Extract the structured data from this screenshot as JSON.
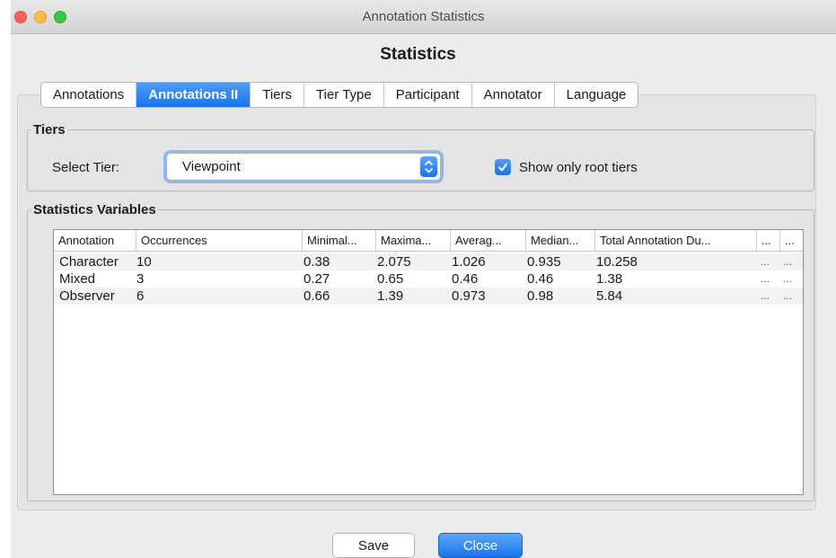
{
  "window": {
    "title": "Annotation Statistics"
  },
  "heading": "Statistics",
  "tabs": [
    {
      "label": "Annotations"
    },
    {
      "label": "Annotations II",
      "active": true
    },
    {
      "label": "Tiers"
    },
    {
      "label": "Tier Type"
    },
    {
      "label": "Participant"
    },
    {
      "label": "Annotator"
    },
    {
      "label": "Language"
    }
  ],
  "tiers_group": {
    "legend": "Tiers",
    "select_label": "Select Tier:",
    "select_value": "Viewpoint",
    "checkbox_label": "Show only root tiers",
    "checkbox_checked": true
  },
  "stats_group": {
    "legend": "Statistics Variables",
    "columns": [
      "Annotation",
      "Occurrences",
      "Minimal...",
      "Maxima...",
      "Averag...",
      "Median...",
      "Total Annotation Du...",
      "...",
      "..."
    ],
    "rows": [
      [
        "Character",
        "10",
        "0.38",
        "2.075",
        "1.026",
        "0.935",
        "10.258",
        "...",
        "..."
      ],
      [
        "Mixed",
        "3",
        "0.27",
        "0.65",
        "0.46",
        "0.46",
        "1.38",
        "...",
        "..."
      ],
      [
        "Observer",
        "6",
        "0.66",
        "1.39",
        "0.973",
        "0.98",
        "5.84",
        "...",
        "..."
      ]
    ]
  },
  "buttons": {
    "save": "Save",
    "close": "Close"
  },
  "colors": {
    "accent": "#1a73e8",
    "window_bg": "#ececec"
  }
}
